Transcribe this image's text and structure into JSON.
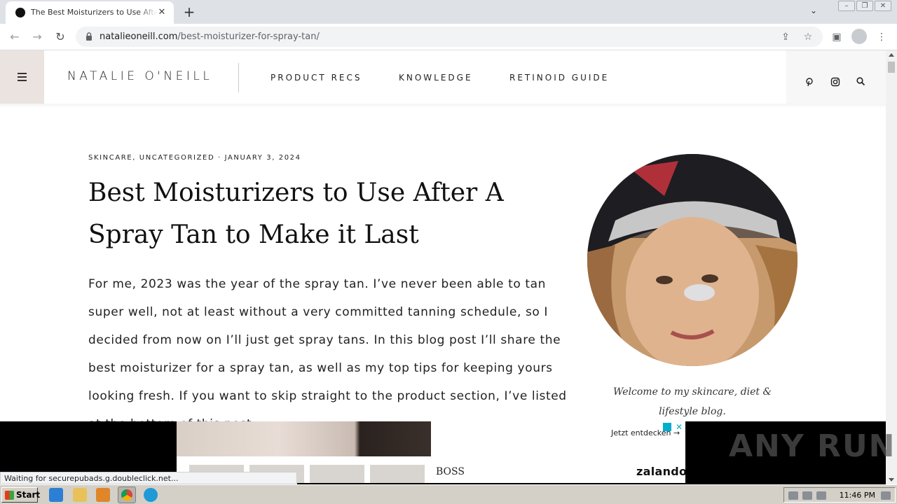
{
  "browser": {
    "tab_title": "The Best Moisturizers to Use After A Spray Tan to Make it Last",
    "tab_close": "✕",
    "new_tab": "+",
    "url_domain": "natalieoneill.com",
    "url_path": "/best-moisturizer-for-spray-tan/",
    "status_text": "Waiting for securepubads.g.doubleclick.net..."
  },
  "site": {
    "logo": "NATALIE O'NEILL",
    "nav": [
      "PRODUCT RECS",
      "KNOWLEDGE",
      "RETINOID GUIDE"
    ],
    "social_icons": [
      "pinterest-icon",
      "instagram-icon",
      "search-icon"
    ]
  },
  "post": {
    "meta": "SKINCARE, UNCATEGORIZED · JANUARY 3, 2024",
    "title": "Best Moisturizers to Use After A Spray Tan to Make it Last",
    "body": "For me, 2023 was the year of the spray tan. I’ve never been able to tan super well, not at least without a very committed tanning schedule, so I decided from now on I’ll just get spray tans. In this blog post I’ll share the best moisturizer for a spray tan, as well as my top tips for keeping yours looking fresh. If you want to skip straight to the product section, I’ve listed at the bottom of this post."
  },
  "sidebar": {
    "welcome": "Welcome to my skincare, diet & lifestyle blog."
  },
  "ad": {
    "cta": "Jetzt entdecken →",
    "brand": "BOSS",
    "logo": "zalando",
    "close": "✕"
  },
  "watermark": "ANY RUN",
  "taskbar": {
    "start": "Start",
    "clock": "11:46 PM"
  }
}
